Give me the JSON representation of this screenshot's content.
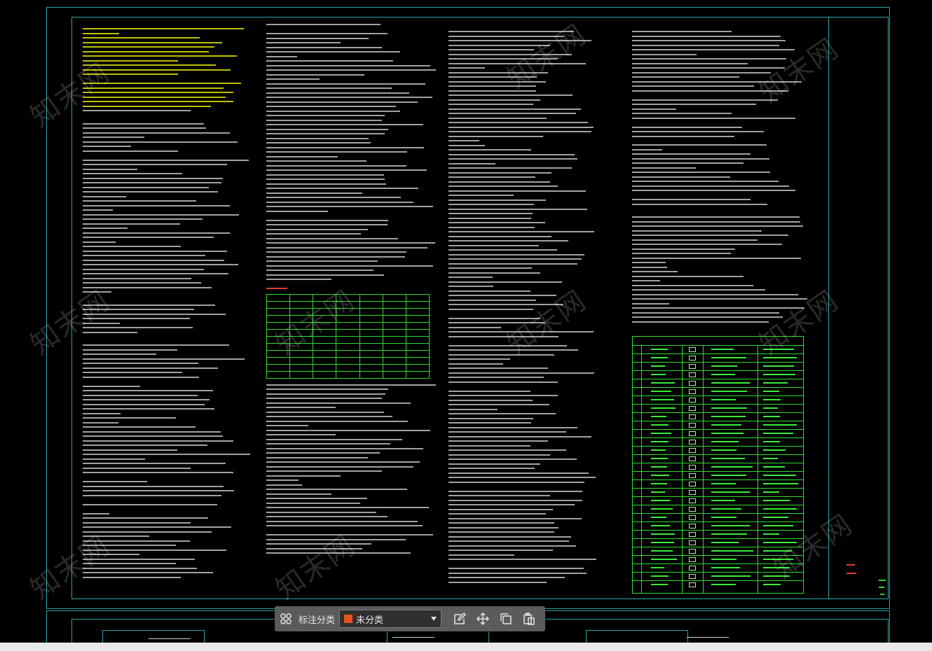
{
  "toolbar": {
    "category_label": "标注分类",
    "category_value": "未分类",
    "category_color": "#e8501e",
    "icons": [
      "apps-grid-icon",
      "edit-icon",
      "move-icon",
      "copy-icon",
      "paste-icon"
    ]
  },
  "drawing": {
    "background": "#000000",
    "frame_color": "#2aa6a6",
    "text_color": "#ffffff",
    "highlight_color": "#ffff00",
    "table_color": "#2fdc2f",
    "accent_red": "#e53935",
    "watermark": "知末网"
  }
}
